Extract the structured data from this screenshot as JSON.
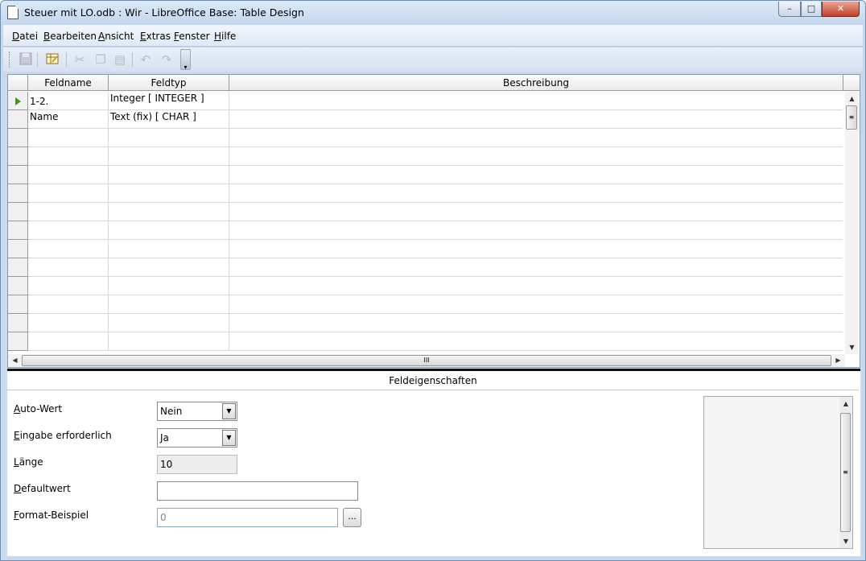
{
  "window": {
    "title": "Steuer mit LO.odb : Wir - LibreOffice Base: Table Design",
    "min_label": "▭",
    "max_label": "□",
    "close_label": "✕"
  },
  "menu": [
    "Datei",
    "Bearbeiten",
    "Ansicht",
    "Extras",
    "Fenster",
    "Hilfe"
  ],
  "toolbar": {
    "icons": [
      "save-icon",
      "edit-index-icon",
      "cut-icon",
      "copy-icon",
      "paste-icon",
      "undo-icon",
      "redo-icon"
    ],
    "overflow": "▾"
  },
  "table": {
    "headers": [
      "Feldname",
      "Feldtyp",
      "Beschreibung"
    ],
    "rows": [
      {
        "name": "1-2.",
        "type": "Integer [ INTEGER ]",
        "description": ""
      },
      {
        "name": "Name",
        "type": "Text (fix) [ CHAR ]",
        "description": ""
      }
    ],
    "scroll_grip": "≡",
    "hscroll_grip": "III"
  },
  "properties": {
    "title": "Feldeigenschaften",
    "auto_wert": {
      "label": "Auto-Wert",
      "value": "Nein"
    },
    "eingabe": {
      "label": "Eingabe erforderlich",
      "value": "Ja"
    },
    "laenge": {
      "label": "Länge",
      "value": "10"
    },
    "default": {
      "label": "Defaultwert",
      "value": ""
    },
    "format": {
      "label": "Format-Beispiel",
      "value": "0",
      "button": "..."
    }
  },
  "colors": {
    "title_bar": "#c5d7ee",
    "close_button": "#c4402a",
    "current_row_arrow": "#3a9a1a"
  }
}
